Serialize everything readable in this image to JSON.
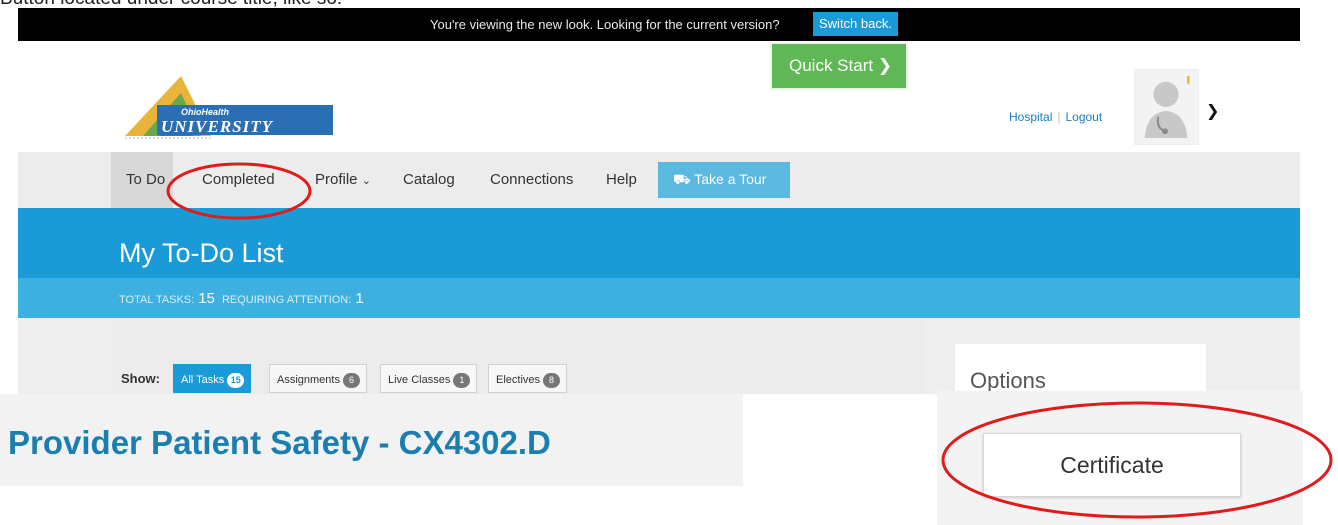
{
  "caption_top": "Button located under course title, like so:",
  "banner": {
    "text": "You're viewing the new look. Looking for the current version?",
    "switch_back_label": "Switch back."
  },
  "header": {
    "logo": {
      "brand_small": "OhioHealth",
      "brand_large": "UNIVERSITY"
    },
    "links": [
      "Hospital",
      "Logout"
    ]
  },
  "nav": {
    "items": [
      "To Do",
      "Completed",
      "Profile",
      "Catalog",
      "Connections",
      "Help"
    ],
    "tour_label": "Take a Tour"
  },
  "hero": {
    "title": "My To-Do List",
    "quick_start_label": "Quick Start",
    "total_tasks_label": "TOTAL TASKS:",
    "total_tasks": "15",
    "requiring_attention_label": "REQUIRING ATTENTION:",
    "requiring_attention": "1"
  },
  "filters": {
    "show_label": "Show:",
    "items": [
      {
        "label": "All Tasks",
        "count": "15",
        "active": true
      },
      {
        "label": "Assignments",
        "count": "6",
        "active": false
      },
      {
        "label": "Live Classes",
        "count": "1",
        "active": false
      },
      {
        "label": "Electives",
        "count": "8",
        "active": false
      }
    ]
  },
  "options_title": "Options",
  "course_title": "Provider Patient Safety - CX4302.D",
  "certificate_label": "Certificate",
  "colors": {
    "brand_blue": "#1a9ad6",
    "light_blue": "#3db0e0",
    "quick_start_green": "#5fb855",
    "annotation_red": "#e01b1b",
    "course_title_blue": "#1a7fb0"
  }
}
